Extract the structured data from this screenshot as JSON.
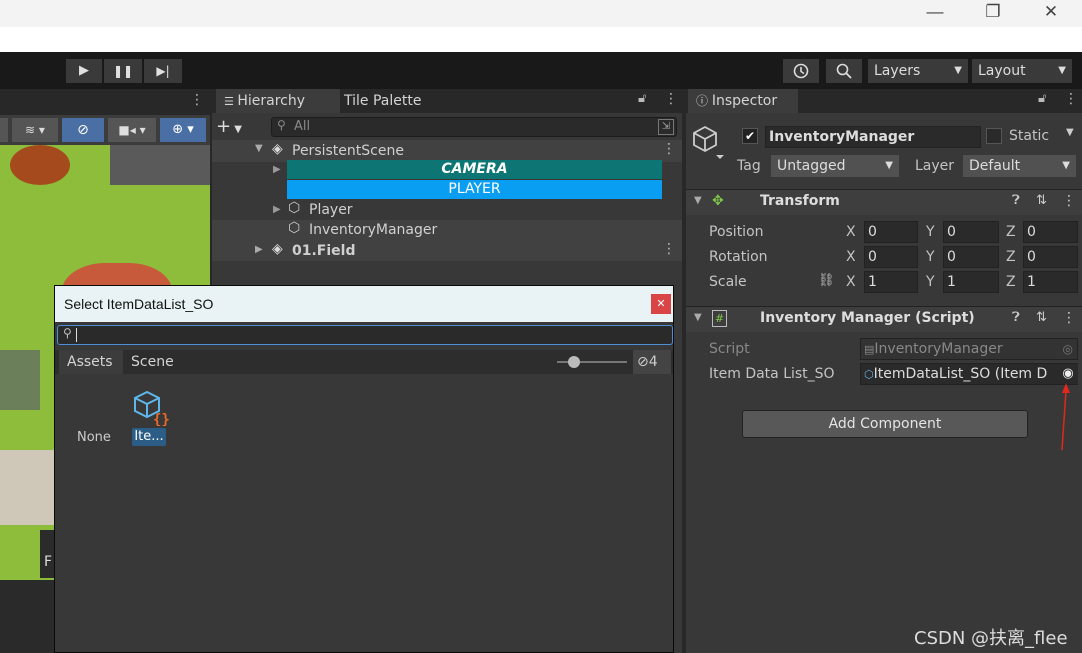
{
  "window": {
    "minimize": "—",
    "restore": "❐",
    "close": "✕"
  },
  "toolbar": {
    "play": "▶",
    "pause": "❚❚",
    "step": "▶|",
    "history_icon": "history-icon",
    "search_icon": "search-icon",
    "layers_label": "Layers",
    "layout_label": "Layout"
  },
  "hierarchy": {
    "tab_label": "Hierarchy",
    "tab2_label": "Tile Palette",
    "search_placeholder": "All",
    "add_label": "+",
    "rows": [
      {
        "label": "PersistentScene"
      },
      {
        "label": "CAMERA"
      },
      {
        "label": "PLAYER"
      },
      {
        "label": "Player"
      },
      {
        "label": "InventoryManager"
      },
      {
        "label": "01.Field"
      }
    ]
  },
  "inspector": {
    "tab_label": "Inspector",
    "object_name": "InventoryManager",
    "static_label": "Static",
    "tag_label": "Tag",
    "tag_value": "Untagged",
    "layer_label": "Layer",
    "layer_value": "Default",
    "transform": {
      "title": "Transform",
      "position_label": "Position",
      "rotation_label": "Rotation",
      "scale_label": "Scale",
      "position": [
        "0",
        "0",
        "0"
      ],
      "rotation": [
        "0",
        "0",
        "0"
      ],
      "scale": [
        "1",
        "1",
        "1"
      ],
      "x": "X",
      "y": "Y",
      "z": "Z"
    },
    "script_comp": {
      "title": "Inventory Manager (Script)",
      "script_label": "Script",
      "script_value": "InventoryManager",
      "field_label": "Item Data List_SO",
      "field_value": "ItemDataList_SO (Item D"
    },
    "add_component": "Add Component"
  },
  "dialog": {
    "title": "Select ItemDataList_SO",
    "close": "✕",
    "tab_assets": "Assets",
    "tab_scene": "Scene",
    "hidden_count": "4",
    "none_label": "None",
    "item_label": "Ite..."
  },
  "scene": {
    "partial_label": "F"
  },
  "watermark": "CSDN @扶离_flee",
  "colors": {
    "accent": "#2c5d87",
    "camera_bg": "#0e7575",
    "player_bg": "#0a9ef2",
    "arrow": "#e0281c"
  }
}
